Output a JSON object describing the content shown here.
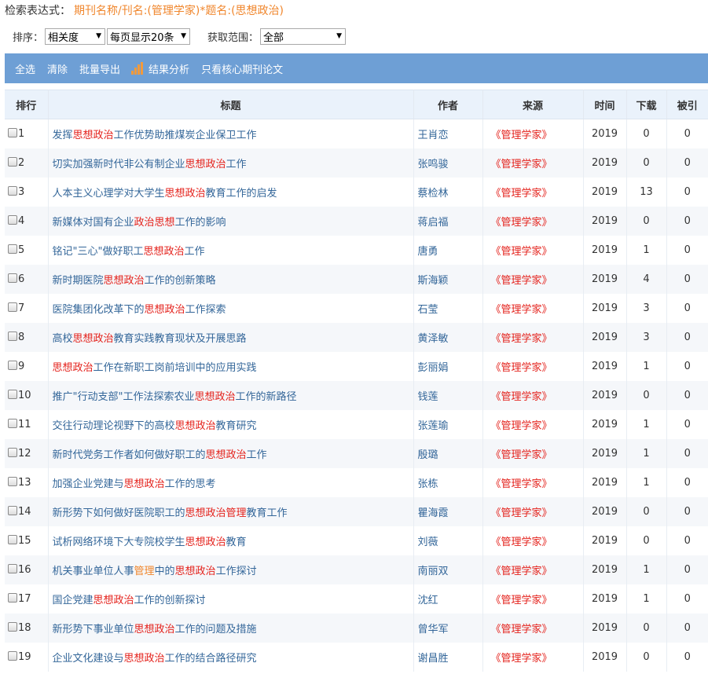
{
  "search": {
    "label": "检索表达式：",
    "expression": "期刊名称/刊名:(管理学家)*题名:(思想政治)"
  },
  "controls": {
    "sort_label": "排序：",
    "sort_value": "相关度",
    "per_page_value": "每页显示20条",
    "range_label": "获取范围：",
    "range_value": "全部"
  },
  "toolbar": {
    "select_all": "全选",
    "clear": "清除",
    "batch_export": "批量导出",
    "analysis": "结果分析",
    "core_only": "只看核心期刊论文"
  },
  "colors": {
    "toolbar_bg": "#6e9fd5",
    "highlight_red": "#e4211b",
    "highlight_orange": "#f0862c",
    "link_blue": "#336699"
  },
  "headers": [
    "排行",
    "标题",
    "作者",
    "来源",
    "时间",
    "下载",
    "被引"
  ],
  "rows": [
    {
      "rank": "1",
      "title": [
        [
          "发挥",
          ""
        ],
        [
          "思想政治",
          "red"
        ],
        [
          "工作优势助推煤炭企业保卫工作",
          ""
        ]
      ],
      "author": "王肖恋",
      "source": "《管理学家》",
      "year": "2019",
      "downloads": "0",
      "citations": "0"
    },
    {
      "rank": "2",
      "title": [
        [
          "切实加强新时代非公有制企业",
          ""
        ],
        [
          "思想政治",
          "red"
        ],
        [
          "工作",
          ""
        ]
      ],
      "author": "张鸣骏",
      "source": "《管理学家》",
      "year": "2019",
      "downloads": "0",
      "citations": "0"
    },
    {
      "rank": "3",
      "title": [
        [
          "人本主义心理学对大学生",
          ""
        ],
        [
          "思想政治",
          "red"
        ],
        [
          "教育工作的启发",
          ""
        ]
      ],
      "author": "蔡检林",
      "source": "《管理学家》",
      "year": "2019",
      "downloads": "13",
      "citations": "0"
    },
    {
      "rank": "4",
      "title": [
        [
          "新媒体对国有企业",
          ""
        ],
        [
          "政治",
          "red"
        ],
        [
          "思想",
          "red"
        ],
        [
          "工作的影响",
          ""
        ]
      ],
      "author": "蒋启福",
      "source": "《管理学家》",
      "year": "2019",
      "downloads": "0",
      "citations": "0"
    },
    {
      "rank": "5",
      "title": [
        [
          "铭记\"三心\"做好职工",
          ""
        ],
        [
          "思想政治",
          "red"
        ],
        [
          "工作",
          ""
        ]
      ],
      "author": "唐勇",
      "source": "《管理学家》",
      "year": "2019",
      "downloads": "1",
      "citations": "0"
    },
    {
      "rank": "6",
      "title": [
        [
          "新时期医院",
          ""
        ],
        [
          "思想政治",
          "red"
        ],
        [
          "工作的创新策略",
          ""
        ]
      ],
      "author": "斯海颖",
      "source": "《管理学家》",
      "year": "2019",
      "downloads": "4",
      "citations": "0"
    },
    {
      "rank": "7",
      "title": [
        [
          "医院集团化改革下的",
          ""
        ],
        [
          "思想政治",
          "red"
        ],
        [
          "工作探索",
          ""
        ]
      ],
      "author": "石莹",
      "source": "《管理学家》",
      "year": "2019",
      "downloads": "3",
      "citations": "0"
    },
    {
      "rank": "8",
      "title": [
        [
          "高校",
          ""
        ],
        [
          "思想政治",
          "red"
        ],
        [
          "教育实践教育现状及开展思路",
          ""
        ]
      ],
      "author": "黄泽敏",
      "source": "《管理学家》",
      "year": "2019",
      "downloads": "3",
      "citations": "0"
    },
    {
      "rank": "9",
      "title": [
        [
          "思想政治",
          "red"
        ],
        [
          "工作在新职工岗前培训中的应用实践",
          ""
        ]
      ],
      "author": "彭丽娟",
      "source": "《管理学家》",
      "year": "2019",
      "downloads": "1",
      "citations": "0"
    },
    {
      "rank": "10",
      "title": [
        [
          "推广\"行动支部\"工作法探索农业",
          ""
        ],
        [
          "思想政治",
          "red"
        ],
        [
          "工作的新路径",
          ""
        ]
      ],
      "author": "钱莲",
      "source": "《管理学家》",
      "year": "2019",
      "downloads": "0",
      "citations": "0"
    },
    {
      "rank": "11",
      "title": [
        [
          "交往行动理论视野下的高校",
          ""
        ],
        [
          "思想政治",
          "red"
        ],
        [
          "教育研究",
          ""
        ]
      ],
      "author": "张莲瑜",
      "source": "《管理学家》",
      "year": "2019",
      "downloads": "1",
      "citations": "0"
    },
    {
      "rank": "12",
      "title": [
        [
          "新时代党务工作者如何做好职工的",
          ""
        ],
        [
          "思想政治",
          "red"
        ],
        [
          "工作",
          ""
        ]
      ],
      "author": "殷璐",
      "source": "《管理学家》",
      "year": "2019",
      "downloads": "1",
      "citations": "0"
    },
    {
      "rank": "13",
      "title": [
        [
          "加强企业党建与",
          ""
        ],
        [
          "思想政治",
          "red"
        ],
        [
          "工作的思考",
          ""
        ]
      ],
      "author": "张栋",
      "source": "《管理学家》",
      "year": "2019",
      "downloads": "1",
      "citations": "0"
    },
    {
      "rank": "14",
      "title": [
        [
          "新形势下如何做好医院职工的",
          ""
        ],
        [
          "思想政治",
          "red"
        ],
        [
          "管理",
          "red"
        ],
        [
          "教育工作",
          ""
        ]
      ],
      "author": "瞿海霞",
      "source": "《管理学家》",
      "year": "2019",
      "downloads": "0",
      "citations": "0"
    },
    {
      "rank": "15",
      "title": [
        [
          "试析网络环境下大专院校学生",
          ""
        ],
        [
          "思想政治",
          "red"
        ],
        [
          "教育",
          ""
        ]
      ],
      "author": "刘薇",
      "source": "《管理学家》",
      "year": "2019",
      "downloads": "0",
      "citations": "0"
    },
    {
      "rank": "16",
      "title": [
        [
          "机关事业单位人事",
          ""
        ],
        [
          "管理",
          "orange"
        ],
        [
          "中的",
          ""
        ],
        [
          "思想政治",
          "red"
        ],
        [
          "工作探讨",
          ""
        ]
      ],
      "author": "南丽双",
      "source": "《管理学家》",
      "year": "2019",
      "downloads": "1",
      "citations": "0"
    },
    {
      "rank": "17",
      "title": [
        [
          "国企党建",
          ""
        ],
        [
          "思想政治",
          "red"
        ],
        [
          "工作的创新探讨",
          ""
        ]
      ],
      "author": "沈红",
      "source": "《管理学家》",
      "year": "2019",
      "downloads": "1",
      "citations": "0"
    },
    {
      "rank": "18",
      "title": [
        [
          "新形势下事业单位",
          ""
        ],
        [
          "思想政治",
          "red"
        ],
        [
          "工作的问题及措施",
          ""
        ]
      ],
      "author": "曾华军",
      "source": "《管理学家》",
      "year": "2019",
      "downloads": "0",
      "citations": "0"
    },
    {
      "rank": "19",
      "title": [
        [
          "企业文化建设与",
          ""
        ],
        [
          "思想政治",
          "red"
        ],
        [
          "工作的结合路径研究",
          ""
        ]
      ],
      "author": "谢昌胜",
      "source": "《管理学家》",
      "year": "2019",
      "downloads": "0",
      "citations": "0"
    }
  ]
}
